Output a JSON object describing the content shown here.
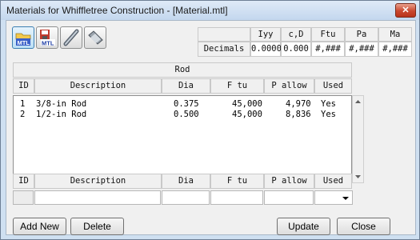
{
  "window": {
    "title": "Materials for Whiffletree Construction - [Material.mtl]",
    "close_glyph": "✕"
  },
  "toolbar": {
    "icons": [
      "open-mtl-icon",
      "save-mtl-icon",
      "rod-icon",
      "beam-icon"
    ]
  },
  "decimals": {
    "headers": [
      "Iyy",
      "c,D",
      "Ftu",
      "Pa",
      "Ma"
    ],
    "row_label": "Decimals",
    "values": [
      "0.0000",
      "0.000",
      "#,###",
      "#,###",
      "#,###"
    ]
  },
  "rod_table": {
    "title": "Rod",
    "columns": [
      "ID",
      "Description",
      "Dia",
      "F tu",
      "P allow",
      "Used"
    ],
    "rows": [
      {
        "id": "1",
        "description": "3/8-in Rod",
        "dia": "0.375",
        "ftu": "45,000",
        "pallow": "4,970",
        "used": "Yes"
      },
      {
        "id": "2",
        "description": "1/2-in Rod",
        "dia": "0.500",
        "ftu": "45,000",
        "pallow": "8,836",
        "used": "Yes"
      }
    ]
  },
  "entry": {
    "columns": [
      "ID",
      "Description",
      "Dia",
      "F tu",
      "P allow",
      "Used"
    ],
    "values": {
      "id": "",
      "description": "",
      "dia": "",
      "ftu": "",
      "pallow": "",
      "used": ""
    }
  },
  "buttons": {
    "add_new": "Add New",
    "delete": "Delete",
    "update": "Update",
    "close": "Close"
  },
  "colors": {
    "title_bg": "#c3d7ee",
    "close_red": "#c9472e",
    "active_btn": "#bcdff5"
  }
}
